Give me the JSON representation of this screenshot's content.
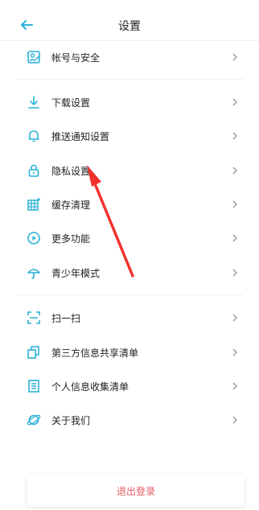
{
  "header": {
    "title": "设置",
    "back_icon": "arrow-left-icon"
  },
  "accent": "#2bb1d9",
  "groups": [
    {
      "items": [
        {
          "label": "帐号与安全",
          "icon": "account-security-icon"
        }
      ]
    },
    {
      "items": [
        {
          "label": "下载设置",
          "icon": "download-icon"
        },
        {
          "label": "推送通知设置",
          "icon": "bell-icon"
        },
        {
          "label": "隐私设置",
          "icon": "lock-icon"
        },
        {
          "label": "缓存清理",
          "icon": "grid-icon"
        },
        {
          "label": "更多功能",
          "icon": "play-circle-icon"
        },
        {
          "label": "青少年模式",
          "icon": "umbrella-icon"
        }
      ]
    },
    {
      "items": [
        {
          "label": "扫一扫",
          "icon": "scan-icon"
        },
        {
          "label": "第三方信息共享清单",
          "icon": "copy-icon"
        },
        {
          "label": "个人信息收集清单",
          "icon": "document-icon"
        },
        {
          "label": "关于我们",
          "icon": "planet-icon"
        }
      ]
    }
  ],
  "logout": {
    "label": "退出登录",
    "color": "#e25b63"
  }
}
